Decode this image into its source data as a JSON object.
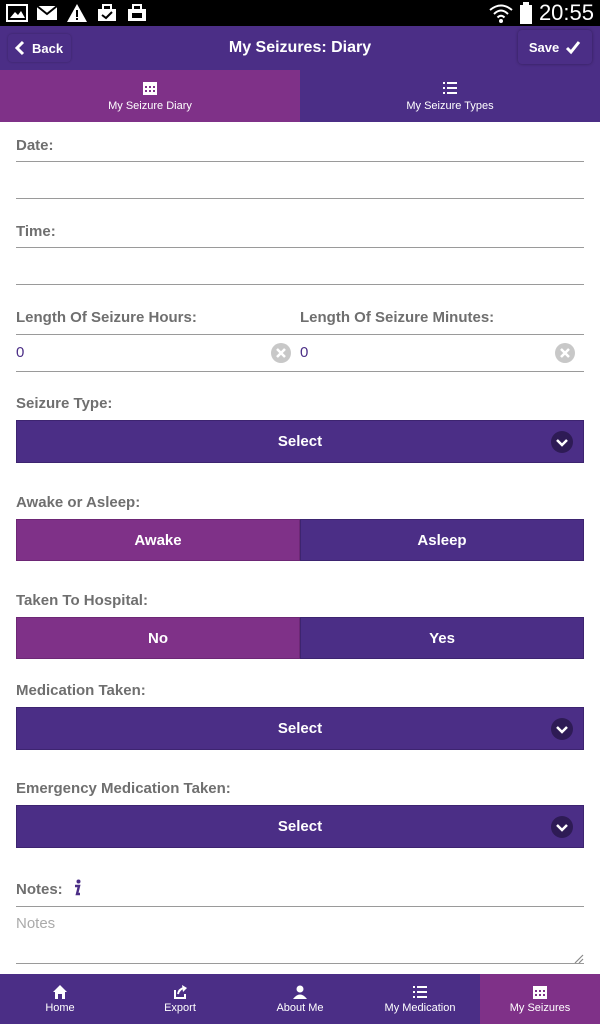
{
  "status_bar": {
    "time": "20:55",
    "left_icons": [
      "gallery-icon",
      "gmail-icon",
      "warning-icon",
      "briefcase-icon",
      "briefcase-icon"
    ],
    "right_icons": [
      "wifi-icon",
      "battery-icon"
    ]
  },
  "header": {
    "back_label": "Back",
    "title": "My Seizures: Diary",
    "save_label": "Save"
  },
  "tabs": [
    {
      "label": "My Seizure Diary",
      "icon": "calendar-icon",
      "active": true
    },
    {
      "label": "My Seizure Types",
      "icon": "list-icon",
      "active": false
    }
  ],
  "form": {
    "date_label": "Date:",
    "date_value": "",
    "time_label": "Time:",
    "time_value": "",
    "hours_label": "Length Of Seizure Hours:",
    "hours_value": "0",
    "minutes_label": "Length Of Seizure Minutes:",
    "minutes_value": "0",
    "seizure_type_label": "Seizure Type:",
    "seizure_type_select": "Select",
    "awake_asleep_label": "Awake or Asleep:",
    "awake_asleep_options": [
      "Awake",
      "Asleep"
    ],
    "awake_asleep_selected": "Awake",
    "hospital_label": "Taken To Hospital:",
    "hospital_options": [
      "No",
      "Yes"
    ],
    "hospital_selected": "No",
    "medication_label": "Medication Taken:",
    "medication_select": "Select",
    "emergency_label": "Emergency Medication Taken:",
    "emergency_select": "Select",
    "notes_label": "Notes:",
    "notes_placeholder": "Notes"
  },
  "bottom_nav": [
    {
      "label": "Home",
      "icon": "home-icon",
      "active": false
    },
    {
      "label": "Export",
      "icon": "export-icon",
      "active": false
    },
    {
      "label": "About Me",
      "icon": "person-icon",
      "active": false
    },
    {
      "label": "My Medication",
      "icon": "list-icon",
      "active": false
    },
    {
      "label": "My Seizures",
      "icon": "calendar-icon",
      "active": true
    }
  ],
  "colors": {
    "primary": "#4b2e86",
    "accent": "#7f3188",
    "label_gray": "#6f6f6f",
    "status_bar": "#000000"
  }
}
